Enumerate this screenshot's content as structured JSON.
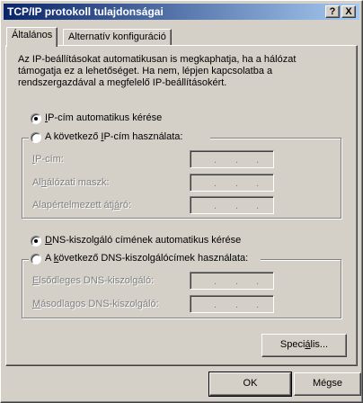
{
  "window": {
    "title": "TCP/IP protokoll tulajdonságai",
    "help_btn": "?",
    "close_btn": "X"
  },
  "tabs": [
    {
      "label": "Általános",
      "active": true
    },
    {
      "label": "Alternatív konfiguráció",
      "active": false
    }
  ],
  "description": "Az IP-beállításokat automatikusan is megkaphatja, ha a hálózat támogatja ez a lehetőséget. Ha nem, lépjen kapcsolatba a rendszergazdával a megfelelő IP-beállításokért.",
  "ip": {
    "auto": {
      "pre": "",
      "u": "I",
      "post": "P-cím automatikus kérése",
      "checked": true
    },
    "manual": {
      "pre": "A következő ",
      "u": "I",
      "post": "P-cím használata:",
      "checked": false
    },
    "fields": [
      {
        "pre": "",
        "u": "I",
        "post": "P-cím:"
      },
      {
        "pre": "Al",
        "u": "h",
        "post": "álózati maszk:"
      },
      {
        "pre": "Alapértelmezett átj",
        "u": "á",
        "post": "ró:"
      }
    ]
  },
  "dns": {
    "auto": {
      "pre": "",
      "u": "D",
      "post": "NS-kiszolgáló címének automatikus kérése",
      "checked": true
    },
    "manual": {
      "pre": "A ",
      "u": "k",
      "post": "övetkező DNS-kiszolgálócímek használata:",
      "checked": false
    },
    "fields": [
      {
        "pre": "",
        "u": "E",
        "post": "lsődleges DNS-kiszolgáló:"
      },
      {
        "pre": "",
        "u": "M",
        "post": "ásodlagos DNS-kiszolgáló:"
      }
    ]
  },
  "buttons": {
    "advanced": {
      "pre": "Speci",
      "u": "á",
      "post": "lis..."
    },
    "ok": "OK",
    "cancel": "Mégse"
  }
}
